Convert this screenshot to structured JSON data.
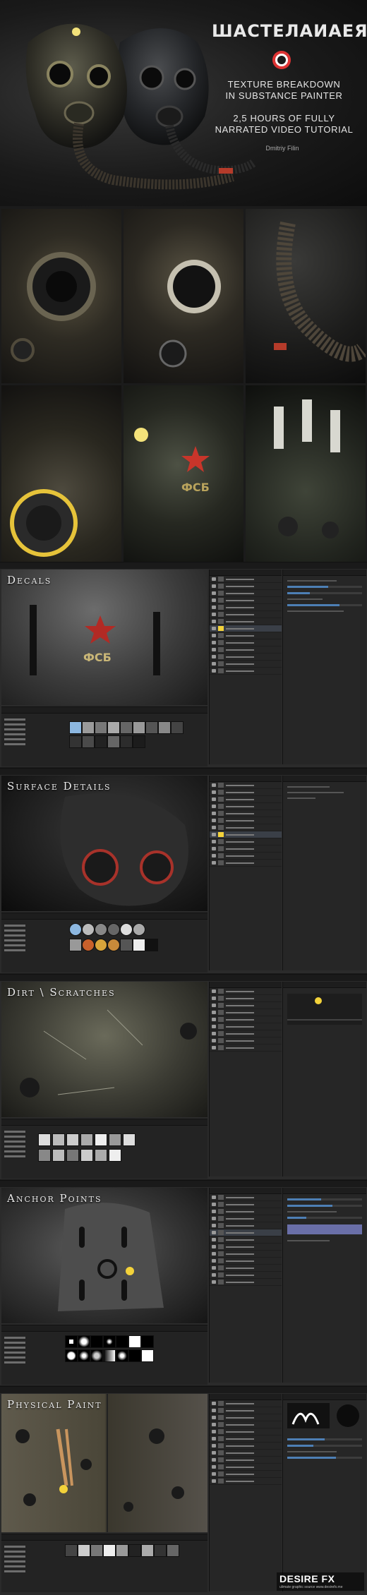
{
  "hero": {
    "logo_text": "ШАСТЕЛАИАЕЯ",
    "line1": "TEXTURE BREAKDOWN",
    "line2": "IN SUBSTANCE PAINTER",
    "line3": "2,5 HOURS OF FULLY",
    "line4": "NARRATED VIDEO TUTORIAL",
    "author": "Dmitriy Filin"
  },
  "panels": [
    {
      "title": "Decals",
      "decal_text": "ФСБ"
    },
    {
      "title": "Surface Details"
    },
    {
      "title": "Dirt \\ Scratches"
    },
    {
      "title": "Anchor Points"
    },
    {
      "title": "Physical Paint"
    }
  ],
  "watermark": {
    "main": "DESIRE FX",
    "sub": "ulimate graphic source  www.desirefx.me"
  },
  "colors": {
    "accent_blue": "#4d7fb5",
    "badge_red": "#d33333",
    "brush_yellow": "#f3d23a"
  }
}
